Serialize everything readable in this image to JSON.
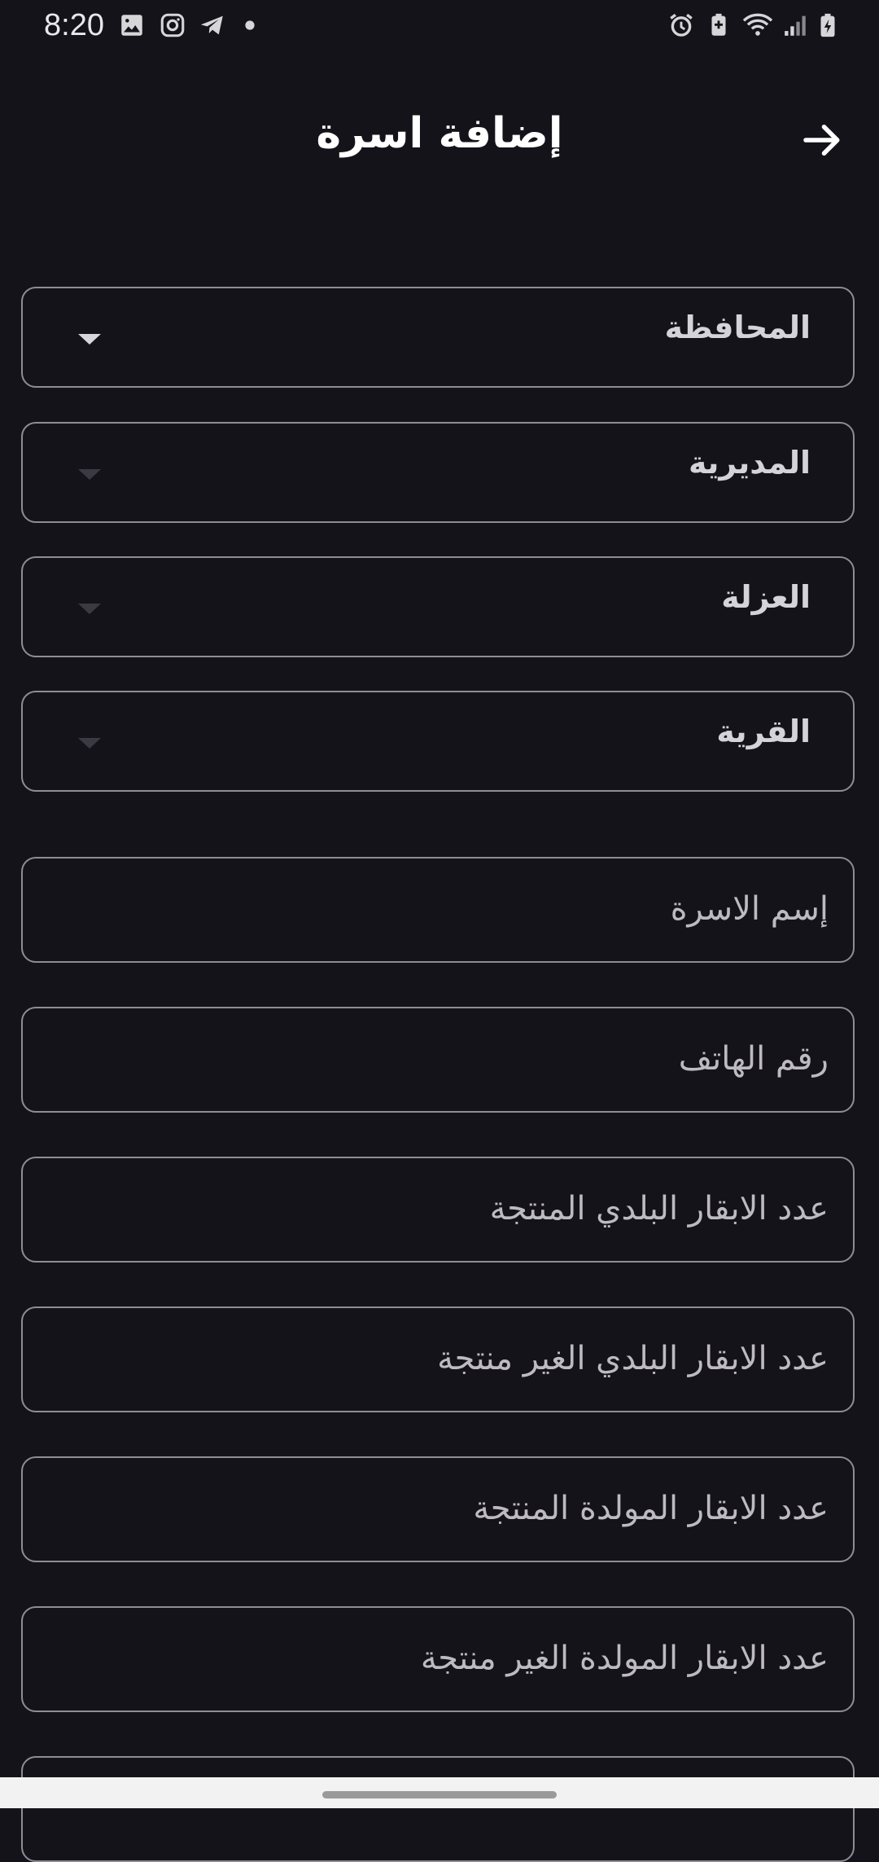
{
  "status_bar": {
    "time": "8:20",
    "left_icons": [
      "image-icon",
      "instagram-icon",
      "telegram-icon",
      "dot-icon"
    ],
    "right_icons": [
      "alarm-icon",
      "battery-saver-icon",
      "wifi-icon",
      "signal-icon",
      "battery-charging-icon"
    ]
  },
  "header": {
    "title": "إضافة اسرة",
    "back_icon": "arrow-right-icon"
  },
  "form": {
    "dropdowns": [
      {
        "label": "المحافظة",
        "enabled": true
      },
      {
        "label": "المديرية",
        "enabled": false
      },
      {
        "label": "العزلة",
        "enabled": false
      },
      {
        "label": "القرية",
        "enabled": false
      }
    ],
    "fields": [
      {
        "placeholder": "إسم الاسرة",
        "value": ""
      },
      {
        "placeholder": "رقم الهاتف",
        "value": ""
      },
      {
        "placeholder": "عدد الابقار البلدي المنتجة",
        "value": ""
      },
      {
        "placeholder": "عدد الابقار البلدي الغير منتجة",
        "value": ""
      },
      {
        "placeholder": "عدد الابقار المولدة المنتجة",
        "value": ""
      },
      {
        "placeholder": "عدد الابقار المولدة الغير منتجة",
        "value": ""
      }
    ]
  },
  "colors": {
    "background": "#15131a",
    "border": "#8f8c96",
    "text": "#ffffff",
    "placeholder": "#bdbac2"
  }
}
